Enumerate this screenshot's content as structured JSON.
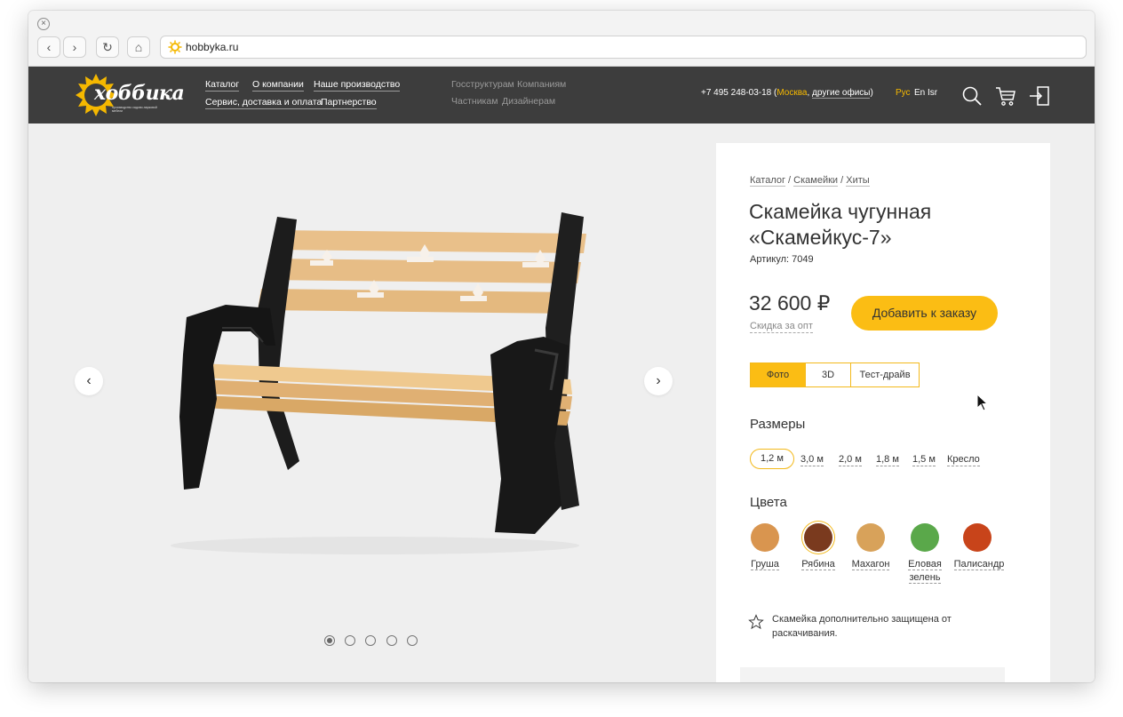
{
  "browser": {
    "url": "hobbyka.ru"
  },
  "header": {
    "logo_text": "хоббика",
    "logo_subtitle": "производство садово-парковой мебели",
    "nav_main": [
      "Каталог",
      "О компании",
      "Наше производство",
      "Сервис, доставка и оплата",
      "Партнерство"
    ],
    "nav_secondary": [
      "Госструктурам",
      "Компаниям",
      "Частникам",
      "Дизайнерам"
    ],
    "phone": "+7 495 248-03-18",
    "city": "Москва",
    "offices": "другие офисы",
    "languages": [
      "Рус",
      "En",
      "Isr"
    ],
    "active_language": "Рус",
    "icons": [
      "search-icon",
      "cart-icon",
      "login-icon"
    ]
  },
  "gallery": {
    "prev_arrow": "‹",
    "next_arrow": "›",
    "slide_count": 5,
    "active_slide": 1
  },
  "product": {
    "breadcrumb": [
      "Каталог",
      "Скамейки",
      "Хиты"
    ],
    "breadcrumb_separator": " / ",
    "title_line1": "Скамейка чугунная",
    "title_line2": "«Скамейкус-7»",
    "article": "Артикул: 7049",
    "price": "32 600 ₽",
    "discount_link": "Скидка за опт",
    "order_button": "Добавить к заказу",
    "view_tabs": [
      "Фото",
      "3D",
      "Тест-драйв"
    ],
    "active_view_tab": "Фото",
    "sizes_label": "Размеры",
    "sizes": [
      "1,2 м",
      "3,0 м",
      "2,0 м",
      "1,8 м",
      "1,5 м",
      "Кресло"
    ],
    "selected_size": "1,2 м",
    "colors_label": "Цвета",
    "colors": [
      {
        "name": "Груша",
        "color": "#d9954f"
      },
      {
        "name": "Рябина",
        "color": "#7a3a1e"
      },
      {
        "name": "Махагон",
        "color": "#d8a25a"
      },
      {
        "name": "Еловая зелень",
        "color": "#5aa84a"
      },
      {
        "name": "Палисандр",
        "color": "#c8441a"
      }
    ],
    "selected_color": "Рябина",
    "note": "Скамейка дополнительно защищена от раскачивания."
  },
  "colors": {
    "accent": "#fbbd14",
    "header_bg": "#3d3d3d",
    "page_bg": "#efefef"
  }
}
